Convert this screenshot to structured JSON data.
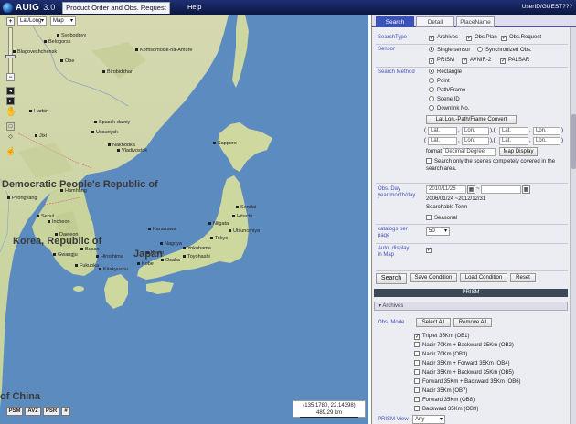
{
  "app": {
    "name": "AUIG",
    "version": "3.0",
    "active_tab": "Product Order and Obs. Request",
    "help": "Help",
    "user": "UserID/GUEST???"
  },
  "map": {
    "crs_select": "Lat/Long",
    "layer_select": "Map",
    "coord_readout": "(135.1780, 22.14398)",
    "scale_readout": "489.29 km",
    "bottom_buttons": [
      "PSM",
      "AV2",
      "PSR",
      "#"
    ],
    "big_labels": [
      "Democratic People's Republic of",
      "Korea, Republic of",
      "Japan",
      "of China"
    ],
    "cities": [
      "Svobodnyy",
      "Belogorsk",
      "Blagoveshchensk",
      "Obe",
      "Komsomolsk-na-Amure",
      "Birobidzhan",
      "Harbin",
      "Jixi",
      "Spassk-dalniy",
      "Ussuriysk",
      "Nakhodka",
      "Vladivostok",
      "Hamhung",
      "Pyongyang",
      "Seoul",
      "Incheon",
      "Daejeon",
      "Busan",
      "Gwangju",
      "Hiroshima",
      "Fukuoka",
      "Kitakyushu",
      "Sapporo",
      "Sendai",
      "Niigata",
      "Utsunomiya",
      "Tokyo",
      "Yokohama",
      "Nagoya",
      "Kyoto",
      "Osaka",
      "Kobe",
      "Kanazawa",
      "Hitachi",
      "Toyohashi",
      "Mito",
      "Chongjin",
      "Usuriysk",
      "Yaroslavka",
      "Yuzhno-Sakhalinsk",
      "Austan",
      "Pyongyang"
    ]
  },
  "panel": {
    "tabs": [
      "Search",
      "Detail",
      "PlaceName"
    ],
    "search_type": {
      "label": "SearchType",
      "options": [
        {
          "label": "Archives",
          "checked": true
        },
        {
          "label": "Obs.Plan",
          "checked": true
        },
        {
          "label": "Obs.Request",
          "checked": true
        }
      ]
    },
    "sensor": {
      "label": "Sensor",
      "modes": [
        {
          "label": "Single sensor",
          "selected": true
        },
        {
          "label": "Synchronized Obs.",
          "selected": false
        }
      ],
      "sensors": [
        {
          "label": "PRISM",
          "checked": true
        },
        {
          "label": "AVNIR-2",
          "checked": true
        },
        {
          "label": "PALSAR",
          "checked": true
        }
      ]
    },
    "method": {
      "label": "Search Method",
      "options": [
        {
          "label": "Rectangle",
          "selected": true
        },
        {
          "label": "Point",
          "selected": false
        },
        {
          "label": "Path/Frame",
          "selected": false
        },
        {
          "label": "Scene ID",
          "selected": false
        },
        {
          "label": "Downlink No.",
          "selected": false
        }
      ],
      "convert_button": "Lat.Lon.-Path/Frame Convert",
      "coords": [
        [
          "Lat.",
          "Lon."
        ],
        [
          "Lat.",
          "Lon."
        ],
        [
          "Lat.",
          "Lon."
        ],
        [
          "Lat.",
          "Lon."
        ]
      ],
      "format_label": "format",
      "format_value": "Decimal Degree",
      "map_display": "Map Display",
      "covered_label": "Search only the scenes completely covered in the search area."
    },
    "obs_day": {
      "label": "Obs. Day year/month/day",
      "from": "2010/11/26",
      "to": "",
      "range": "2006/01/24 ~2012/12/31",
      "term": "Searchable Term",
      "seasonal": "Seasonal"
    },
    "catalogs": {
      "label": "catalogs per page",
      "value": "50"
    },
    "auto_display": {
      "label": "Auto. display in Map",
      "checked": true
    },
    "actions": [
      "Search",
      "Save Condition",
      "Load Condition",
      "Reset"
    ],
    "prism_header": "PRISM",
    "archives_header": "Archives",
    "obs_mode": {
      "label": "Obs. Mode",
      "select_all": "Select All",
      "remove_all": "Remove All",
      "items": [
        {
          "label": "Triplet 35Km (OB1)",
          "checked": true
        },
        {
          "label": "Nadir 70Km + Backward 35Km (OB2)",
          "checked": false
        },
        {
          "label": "Nadir 70Km (OB3)",
          "checked": false
        },
        {
          "label": "Nadir 35Km + Forward 35Km (OB4)",
          "checked": false
        },
        {
          "label": "Nadir 35Km + Backward 35Km (OB5)",
          "checked": false
        },
        {
          "label": "Forward 35Km + Backward 35Km (OB6)",
          "checked": false
        },
        {
          "label": "Nadir 35Km (OB7)",
          "checked": false
        },
        {
          "label": "Forward 35Km (OB8)",
          "checked": false
        },
        {
          "label": "Backward 35Km (OB9)",
          "checked": false
        }
      ]
    },
    "prism_view": {
      "label": "PRISM View",
      "value": "Any"
    }
  },
  "colors": {
    "sea": "#5f8dc0",
    "land": "#cfd8a0",
    "panel_bg": "#ecedf2",
    "accent": "#3b53b8",
    "topbar": "#1f2f72"
  }
}
